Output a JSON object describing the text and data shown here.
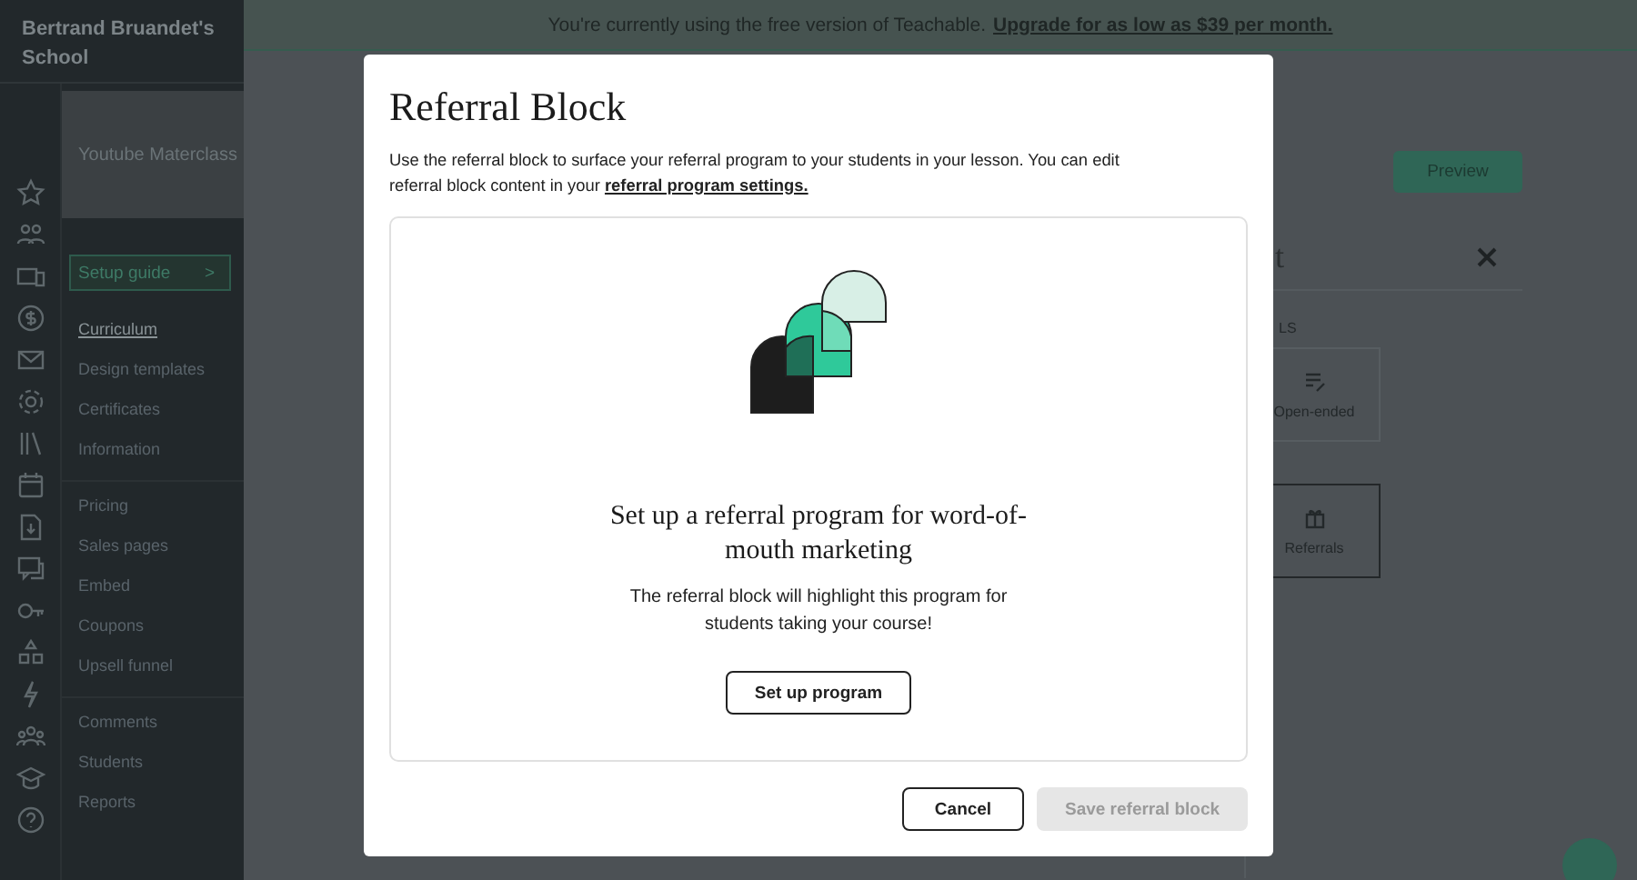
{
  "school_name": "Bertrand Bruandet's School",
  "course": {
    "title": "Youtube Materclass"
  },
  "setup_guide": {
    "label": "Setup guide",
    "icon": ">"
  },
  "nav_groups": [
    [
      {
        "label": "Curriculum",
        "selected": true
      },
      {
        "label": "Design templates",
        "selected": false
      },
      {
        "label": "Certificates",
        "selected": false
      },
      {
        "label": "Information",
        "selected": false
      }
    ],
    [
      {
        "label": "Pricing",
        "selected": false
      },
      {
        "label": "Sales pages",
        "selected": false
      },
      {
        "label": "Embed",
        "selected": false
      },
      {
        "label": "Coupons",
        "selected": false
      },
      {
        "label": "Upsell funnel",
        "selected": false
      }
    ],
    [
      {
        "label": "Comments",
        "selected": false
      },
      {
        "label": "Students",
        "selected": false
      },
      {
        "label": "Reports",
        "selected": false
      }
    ]
  ],
  "banner": {
    "text": "You're currently using the free version of Teachable.",
    "link": "Upgrade for as low as $39 per month."
  },
  "preview_button": "Preview",
  "side_panel": {
    "title": "t",
    "section_label": "LS",
    "blocks": [
      {
        "label": "Open-ended",
        "kind": "open-ended",
        "selected": false
      },
      {
        "label": "Referrals",
        "kind": "referrals",
        "selected": true
      }
    ]
  },
  "modal": {
    "title": "Referral Block",
    "description": "Use the referral block to surface your referral program to your students in your lesson. You can edit referral block content in your",
    "description_link": "referral program settings.",
    "heading": "Set up a referral program for word-of-mouth marketing",
    "body": "The referral block will highlight this program for students taking your course!",
    "setup_button": "Set up program",
    "cancel_button": "Cancel",
    "save_button": {
      "label": "Save referral block",
      "disabled": true
    }
  }
}
